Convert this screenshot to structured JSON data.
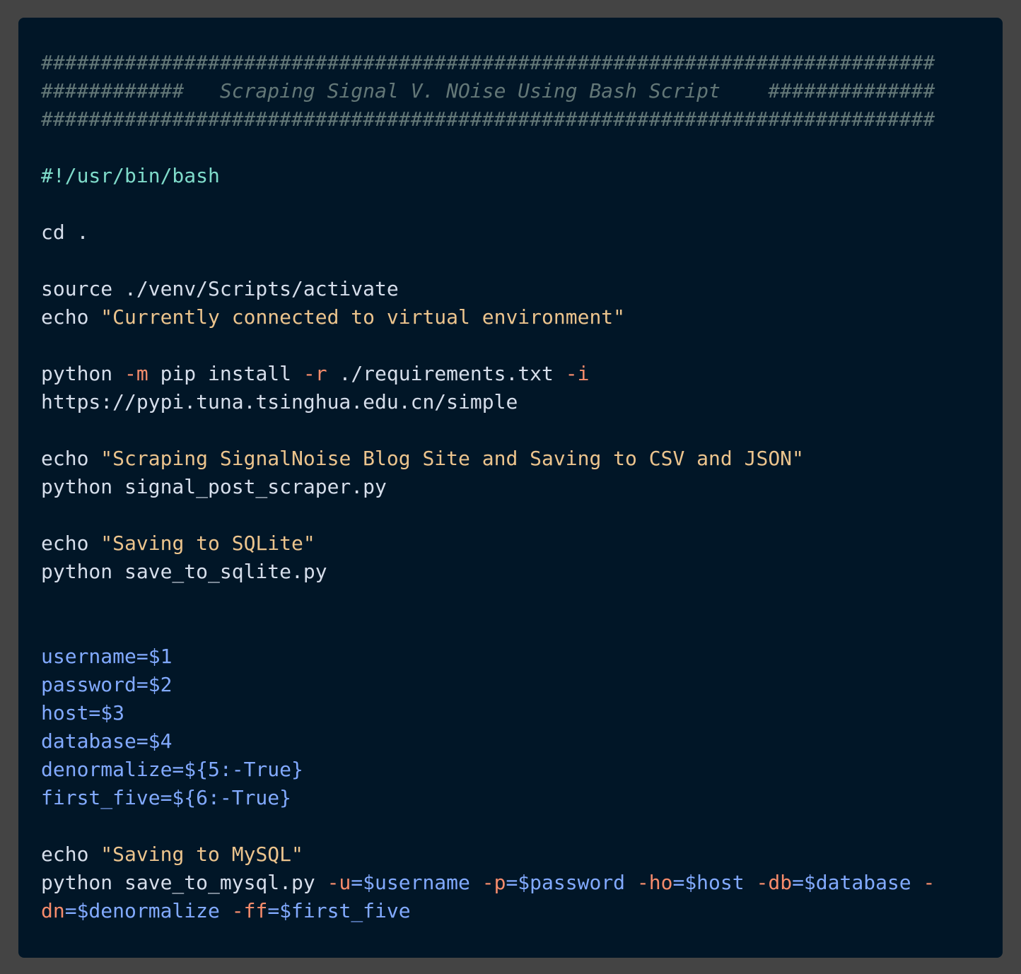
{
  "lines": [
    [
      {
        "t": "cmt",
        "v": "###########################################################################"
      }
    ],
    [
      {
        "t": "cmt",
        "v": "############   Scraping Signal V. NOise Using Bash Script    ##############"
      }
    ],
    [
      {
        "t": "cmt",
        "v": "###########################################################################"
      }
    ],
    [],
    [
      {
        "t": "shebang",
        "v": "#!/usr/bin/bash"
      }
    ],
    [],
    [
      {
        "t": "plain",
        "v": "cd ."
      }
    ],
    [],
    [
      {
        "t": "plain",
        "v": "source ./venv/Scripts/activate"
      }
    ],
    [
      {
        "t": "plain",
        "v": "echo "
      },
      {
        "t": "str",
        "v": "\"Currently connected to virtual environment\""
      }
    ],
    [],
    [
      {
        "t": "plain",
        "v": "python "
      },
      {
        "t": "flag",
        "v": "-m"
      },
      {
        "t": "plain",
        "v": " pip install "
      },
      {
        "t": "flag",
        "v": "-r"
      },
      {
        "t": "plain",
        "v": " ./requirements.txt "
      },
      {
        "t": "flag",
        "v": "-i"
      }
    ],
    [
      {
        "t": "plain",
        "v": "https://pypi.tuna.tsinghua.edu.cn/simple"
      }
    ],
    [],
    [
      {
        "t": "plain",
        "v": "echo "
      },
      {
        "t": "str",
        "v": "\"Scraping SignalNoise Blog Site and Saving to CSV and JSON\""
      }
    ],
    [
      {
        "t": "plain",
        "v": "python signal_post_scraper.py"
      }
    ],
    [],
    [
      {
        "t": "plain",
        "v": "echo "
      },
      {
        "t": "str",
        "v": "\"Saving to SQLite\""
      }
    ],
    [
      {
        "t": "plain",
        "v": "python save_to_sqlite.py"
      }
    ],
    [],
    [],
    [
      {
        "t": "var",
        "v": "username=$1"
      }
    ],
    [
      {
        "t": "var",
        "v": "password=$2"
      }
    ],
    [
      {
        "t": "var",
        "v": "host=$3"
      }
    ],
    [
      {
        "t": "var",
        "v": "database=$4"
      }
    ],
    [
      {
        "t": "var",
        "v": "denormalize=${5:-True}"
      }
    ],
    [
      {
        "t": "var",
        "v": "first_five=${6:-True}"
      }
    ],
    [],
    [
      {
        "t": "plain",
        "v": "echo "
      },
      {
        "t": "str",
        "v": "\"Saving to MySQL\""
      }
    ],
    [
      {
        "t": "plain",
        "v": "python save_to_mysql.py "
      },
      {
        "t": "flag",
        "v": "-u"
      },
      {
        "t": "var",
        "v": "=$username "
      },
      {
        "t": "flag",
        "v": "-p"
      },
      {
        "t": "var",
        "v": "=$password "
      },
      {
        "t": "flag",
        "v": "-ho"
      },
      {
        "t": "var",
        "v": "=$host "
      },
      {
        "t": "flag",
        "v": "-db"
      },
      {
        "t": "var",
        "v": "=$database "
      },
      {
        "t": "flag",
        "v": "-"
      }
    ],
    [
      {
        "t": "flag",
        "v": "dn"
      },
      {
        "t": "var",
        "v": "=$denormalize "
      },
      {
        "t": "flag",
        "v": "-ff"
      },
      {
        "t": "var",
        "v": "=$first_five"
      }
    ]
  ]
}
